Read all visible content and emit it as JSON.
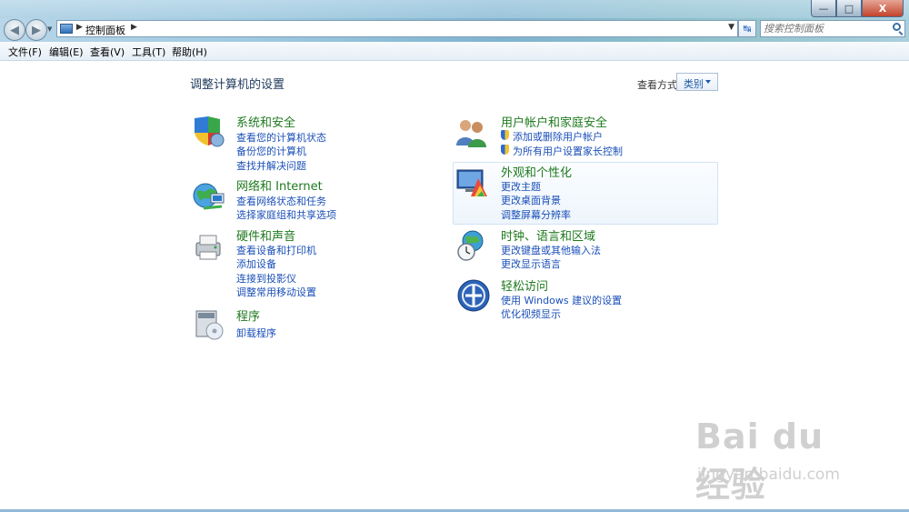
{
  "window": {
    "min_symbol": "—",
    "max_symbol": "□",
    "close_symbol": "X"
  },
  "nav": {
    "back_symbol": "◀",
    "forward_symbol": "▶",
    "history_symbol": "▼"
  },
  "address": {
    "crumb": "控制面板",
    "sep": "▶",
    "drop": "▼",
    "refresh_symbol": "↹"
  },
  "search": {
    "placeholder": "搜索控制面板"
  },
  "menu": {
    "file": "文件(F)",
    "edit": "编辑(E)",
    "view": "查看(V)",
    "tools": "工具(T)",
    "help": "帮助(H)"
  },
  "page": {
    "heading": "调整计算机的设置",
    "view_label": "查看方式:",
    "view_value": "类别"
  },
  "categories": {
    "system": {
      "title": "系统和安全",
      "links": [
        "查看您的计算机状态",
        "备份您的计算机",
        "查找并解决问题"
      ]
    },
    "network": {
      "title": "网络和 Internet",
      "links": [
        "查看网络状态和任务",
        "选择家庭组和共享选项"
      ]
    },
    "hardware": {
      "title": "硬件和声音",
      "links": [
        "查看设备和打印机",
        "添加设备",
        "连接到投影仪",
        "调整常用移动设置"
      ]
    },
    "programs": {
      "title": "程序",
      "links": [
        "卸载程序"
      ]
    },
    "users": {
      "title": "用户帐户和家庭安全",
      "links": [
        "添加或删除用户帐户",
        "为所有用户设置家长控制"
      ]
    },
    "appearance": {
      "title": "外观和个性化",
      "links": [
        "更改主题",
        "更改桌面背景",
        "调整屏幕分辨率"
      ]
    },
    "clock": {
      "title": "时钟、语言和区域",
      "links": [
        "更改键盘或其他输入法",
        "更改显示语言"
      ]
    },
    "ease": {
      "title": "轻松访问",
      "links": [
        "使用 Windows 建议的设置",
        "优化视频显示"
      ]
    }
  },
  "watermark": {
    "logo": "Bai du 经验",
    "url": "jingyan.baidu.com"
  }
}
